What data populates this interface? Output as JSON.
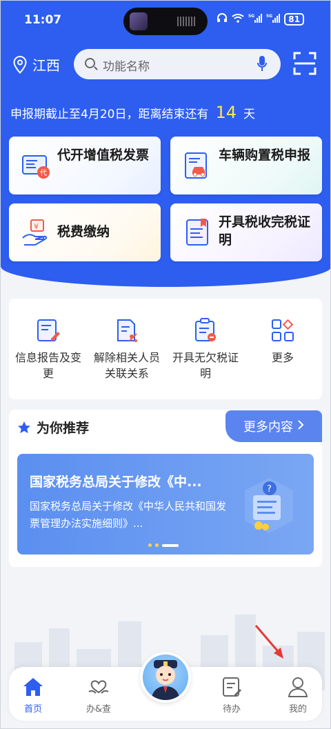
{
  "status": {
    "time": "11:07",
    "battery": "81",
    "signal1": "5G",
    "signal2": "5G"
  },
  "header": {
    "location": "江西",
    "search_placeholder": "功能名称",
    "deadline_prefix": "申报期截止至4月20日，距离结束还有",
    "deadline_days": "14",
    "deadline_suffix": "天"
  },
  "services": [
    {
      "label": "代开增值税发票",
      "icon": "invoice-icon"
    },
    {
      "label": "车辆购置税申报",
      "icon": "vehicle-tax-icon"
    },
    {
      "label": "税费缴纳",
      "icon": "tax-payment-icon"
    },
    {
      "label": "开具税收完税证明",
      "icon": "tax-certificate-icon"
    }
  ],
  "quick": [
    {
      "label": "信息报告及变更",
      "icon": "info-report-icon"
    },
    {
      "label": "解除相关人员关联关系",
      "icon": "unlink-relation-icon"
    },
    {
      "label": "开具无欠税证明",
      "icon": "no-arrears-certificate-icon"
    },
    {
      "label": "更多",
      "icon": "more-grid-icon"
    }
  ],
  "recommend": {
    "title": "为你推荐",
    "more": "更多内容",
    "banner_title": "国家税务总局关于修改《中...",
    "banner_desc": "国家税务总局关于修改《中华人民共和国发票管理办法实施细则》..."
  },
  "nav": [
    {
      "label": "首页",
      "icon": "home-icon",
      "active": true
    },
    {
      "label": "办&查",
      "icon": "handle-check-icon",
      "active": false
    },
    {
      "label": "待办",
      "icon": "todo-icon",
      "active": false
    },
    {
      "label": "我的",
      "icon": "profile-icon",
      "active": false
    }
  ],
  "colors": {
    "primary": "#2d5ef0",
    "highlight": "#ffe74a",
    "accent_red": "#e53935"
  }
}
